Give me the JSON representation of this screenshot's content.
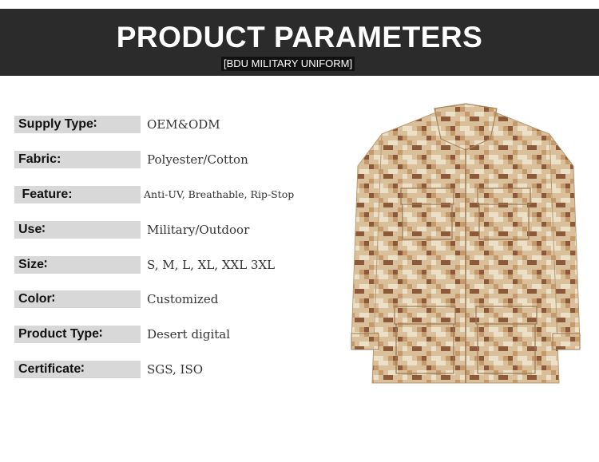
{
  "header": {
    "title": "PRODUCT PARAMETERS",
    "subtitle": "[BDU MILITARY UNIFORM]"
  },
  "params": [
    {
      "label": "Supply Type∶",
      "value": "OEM&ODM"
    },
    {
      "label": "Fabric:",
      "value": "Polyester/Cotton"
    },
    {
      "label": " Feature:",
      "value": "Anti-UV, Breathable, Rip-Stop"
    },
    {
      "label": "Use∶",
      "value": "Military/Outdoor"
    },
    {
      "label": "Size∶",
      "value": "S, M, L, XL, XXL 3XL"
    },
    {
      "label": "Color∶",
      "value": "Customized"
    },
    {
      "label": "Product Type∶",
      "value": "Desert digital"
    },
    {
      "label": "Certificate∶",
      "value": "SGS, ISO"
    }
  ],
  "colors": {
    "header_bg": "#2b2b2b",
    "label_bg": "#d8d8d8",
    "camo_base": "#d9c09a",
    "camo_light": "#ece0c6",
    "camo_mid": "#c49a6c",
    "camo_dark": "#8c5a3a"
  },
  "image": {
    "subject": "desert digital camouflage BDU jacket"
  }
}
